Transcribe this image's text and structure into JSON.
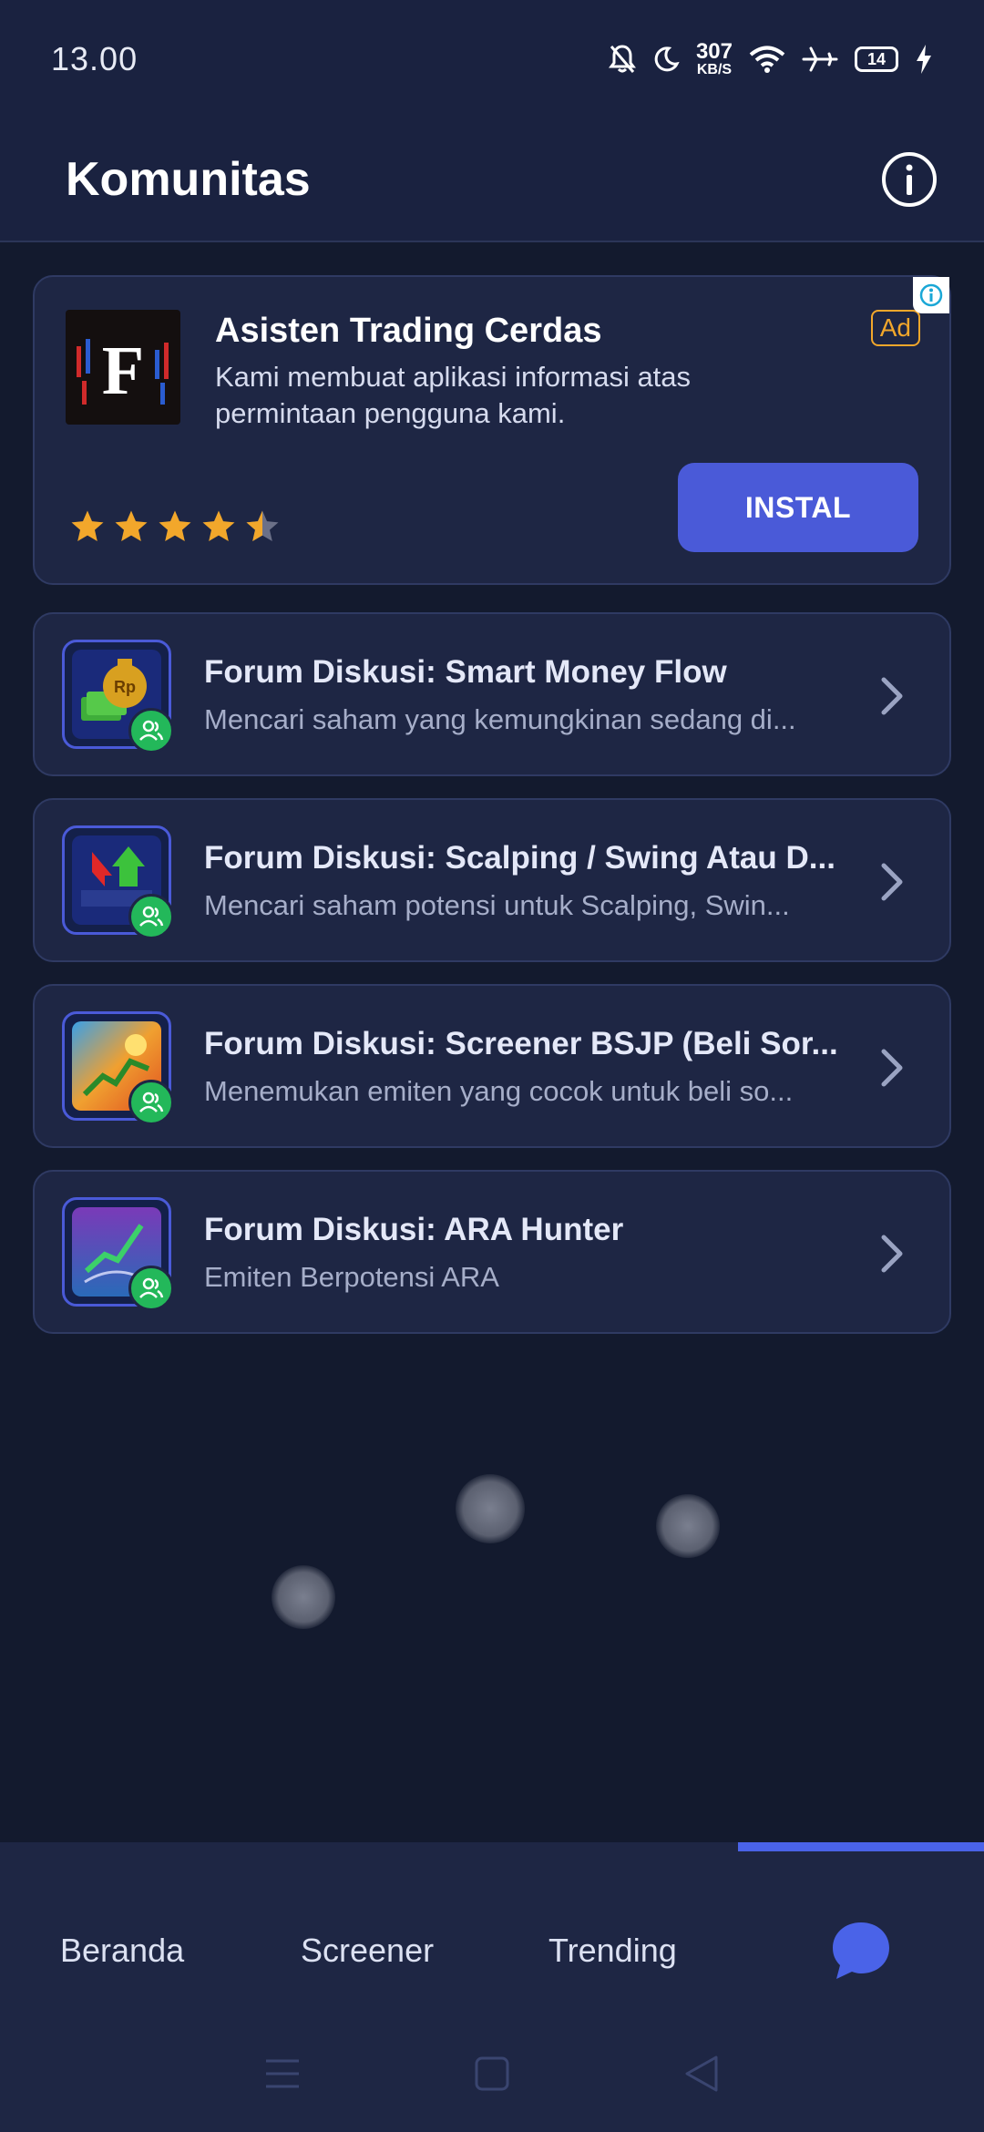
{
  "status_bar": {
    "time": "13.00",
    "net_speed_value": "307",
    "net_speed_unit": "KB/S",
    "battery": "14"
  },
  "header": {
    "title": "Komunitas"
  },
  "ad": {
    "title": "Asisten Trading Cerdas",
    "description": "Kami membuat aplikasi informasi atas permintaan pengguna kami.",
    "badge": "Ad",
    "install_label": "INSTAL",
    "rating": 4.5
  },
  "forums": [
    {
      "title": "Forum Diskusi: Smart Money Flow",
      "subtitle": "Mencari saham yang kemungkinan sedang di..."
    },
    {
      "title": "Forum Diskusi: Scalping / Swing Atau D...",
      "subtitle": "Mencari saham potensi untuk Scalping, Swin..."
    },
    {
      "title": "Forum Diskusi: Screener BSJP (Beli Sor...",
      "subtitle": "Menemukan emiten yang cocok untuk beli so..."
    },
    {
      "title": "Forum Diskusi: ARA Hunter",
      "subtitle": "Emiten Berpotensi ARA"
    }
  ],
  "bottom_nav": {
    "items": [
      "Beranda",
      "Screener",
      "Trending"
    ],
    "active": "chat"
  },
  "colors": {
    "background": "#131a2e",
    "card": "#1e2644",
    "accent": "#4a5ad8",
    "star": "#f2a72b",
    "group_badge": "#23b85a"
  }
}
